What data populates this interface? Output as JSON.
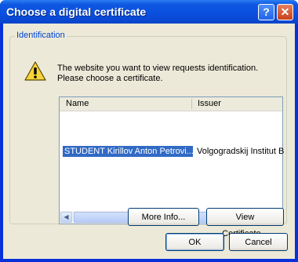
{
  "window": {
    "title": "Choose a digital certificate",
    "help_glyph": "?",
    "close_glyph": "✕"
  },
  "identification": {
    "group_label": "Identification",
    "message_line1": "The website you want to view requests identification.",
    "message_line2": "Please choose a certificate."
  },
  "certificate_list": {
    "columns": [
      "Name",
      "Issuer"
    ],
    "rows": [
      {
        "name": "STUDENT Kirillov Anton Petrovi...",
        "issuer": "Volgogradskij Institut B",
        "selected": true
      }
    ]
  },
  "buttons": {
    "more_info": "More Info...",
    "view_certificate": "View Certificate...",
    "ok": "OK",
    "cancel": "Cancel"
  },
  "colors": {
    "titlebar": "#0a4ee0",
    "selection": "#316ac5",
    "group_label": "#0046d5",
    "dialog_face": "#ece9d8"
  },
  "icons": {
    "warning": "warning-icon",
    "scroll_left": "scroll-left-arrow-icon",
    "scroll_right": "scroll-right-arrow-icon"
  }
}
